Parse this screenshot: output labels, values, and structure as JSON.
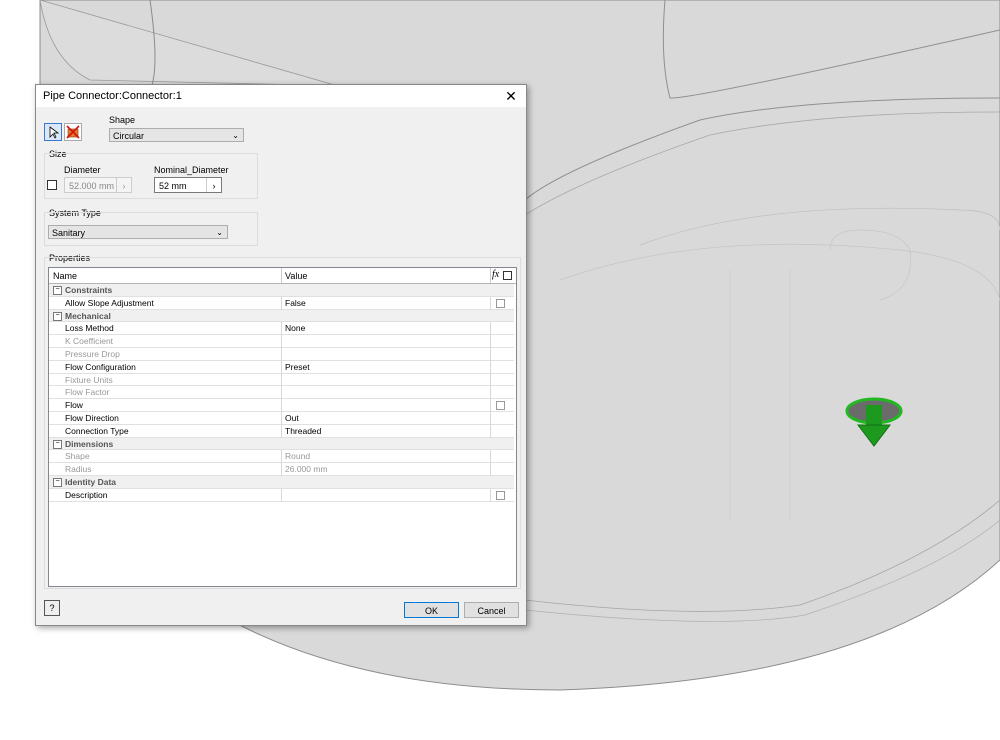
{
  "dialog": {
    "title": "Pipe Connector:Connector:1",
    "close_glyph": "✕",
    "shape_label": "Shape",
    "shape_value": "Circular",
    "size_group_label": "Size",
    "diameter_label": "Diameter",
    "diameter_value": "52.000 mm",
    "nominal_label": "Nominal_Diameter",
    "nominal_value": "52 mm",
    "system_type_label": "System Type",
    "system_type_value": "Sanitary",
    "properties_label": "Properties",
    "grid_header": {
      "name": "Name",
      "value": "Value",
      "fx": "fx"
    },
    "rows": [
      {
        "type": "category",
        "name": "Constraints"
      },
      {
        "type": "prop",
        "name": "Allow Slope Adjustment",
        "value": "False",
        "check": true,
        "disabled": false
      },
      {
        "type": "category",
        "name": "Mechanical"
      },
      {
        "type": "prop",
        "name": "Loss Method",
        "value": "None",
        "check": false,
        "disabled": false
      },
      {
        "type": "prop",
        "name": "K Coefficient",
        "value": "",
        "check": false,
        "disabled": true
      },
      {
        "type": "prop",
        "name": "Pressure Drop",
        "value": "",
        "check": false,
        "disabled": true
      },
      {
        "type": "prop",
        "name": "Flow Configuration",
        "value": "Preset",
        "check": false,
        "disabled": false
      },
      {
        "type": "prop",
        "name": "Fixture Units",
        "value": "",
        "check": false,
        "disabled": true
      },
      {
        "type": "prop",
        "name": "Flow Factor",
        "value": "",
        "check": false,
        "disabled": true
      },
      {
        "type": "prop",
        "name": "Flow",
        "value": "",
        "check": true,
        "disabled": false
      },
      {
        "type": "prop",
        "name": "Flow Direction",
        "value": "Out",
        "check": false,
        "disabled": false
      },
      {
        "type": "prop",
        "name": "Connection Type",
        "value": "Threaded",
        "check": false,
        "disabled": false
      },
      {
        "type": "category",
        "name": "Dimensions"
      },
      {
        "type": "prop",
        "name": "Shape",
        "value": "Round",
        "check": false,
        "disabled": true
      },
      {
        "type": "prop",
        "name": "Radius",
        "value": "26.000 mm",
        "check": false,
        "disabled": true
      },
      {
        "type": "category",
        "name": "Identity Data"
      },
      {
        "type": "prop",
        "name": "Description",
        "value": "",
        "check": true,
        "disabled": false
      }
    ],
    "ok_label": "OK",
    "cancel_label": "Cancel",
    "help_glyph": "?"
  },
  "colors": {
    "accent": "#3a78d4",
    "connector_green": "#1fa81f"
  }
}
